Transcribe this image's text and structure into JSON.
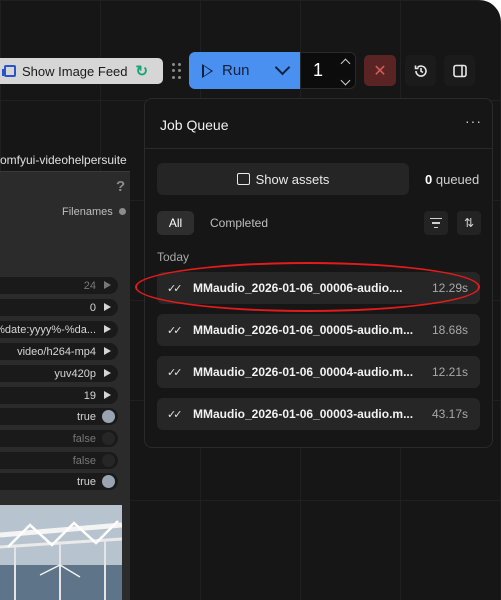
{
  "toolbar": {
    "show_image_feed_label": "Show Image Feed",
    "run_label": "Run",
    "batch_count": "1",
    "cancel_icon": "close-icon",
    "history_icon": "history-icon",
    "panel_icon": "panel-toggle-icon"
  },
  "node": {
    "title": "omfyui-videohelpersuite",
    "help": "?",
    "filenames_label": "Filenames",
    "widgets": [
      {
        "value": "24",
        "kind": "number",
        "dim": true
      },
      {
        "value": "0",
        "kind": "number",
        "dim": false
      },
      {
        "value": "%date:yyyy%-%da...",
        "kind": "text",
        "dim": false
      },
      {
        "value": "video/h264-mp4",
        "kind": "combo",
        "dim": false
      },
      {
        "value": "yuv420p",
        "kind": "combo",
        "dim": false
      },
      {
        "value": "19",
        "kind": "number",
        "dim": false
      },
      {
        "value": "true",
        "kind": "toggle",
        "dim": false
      },
      {
        "value": "false",
        "kind": "toggle",
        "dim": true
      },
      {
        "value": "false",
        "kind": "toggle",
        "dim": true
      },
      {
        "value": "true",
        "kind": "toggle",
        "dim": false
      }
    ]
  },
  "job_queue": {
    "title": "Job Queue",
    "more_label": "···",
    "show_assets_label": "Show assets",
    "queued_count": "0",
    "queued_label": "queued",
    "tabs": {
      "all": "All",
      "completed": "Completed"
    },
    "section_today": "Today",
    "jobs": [
      {
        "name": "MMaudio_2026-01-06_00006-audio....",
        "duration": "12.29s"
      },
      {
        "name": "MMaudio_2026-01-06_00005-audio.m...",
        "duration": "18.68s"
      },
      {
        "name": "MMaudio_2026-01-06_00004-audio.m...",
        "duration": "12.21s"
      },
      {
        "name": "MMaudio_2026-01-06_00003-audio.m...",
        "duration": "43.17s"
      }
    ]
  },
  "colors": {
    "run_blue": "#4a90f0",
    "cancel_red": "#5a2424",
    "highlight_red": "#e21b1b",
    "panel_bg": "#161616"
  }
}
